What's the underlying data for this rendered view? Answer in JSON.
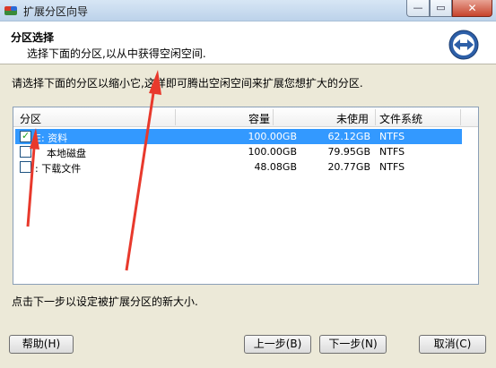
{
  "window": {
    "title": "扩展分区向导",
    "min_glyph": "—",
    "max_glyph": "▭",
    "close_glyph": "✕"
  },
  "header": {
    "title": "分区选择",
    "subtitle": "选择下面的分区,以从中获得空闲空间."
  },
  "instruction": "请选择下面的分区以缩小它,这样即可腾出空闲空间来扩展您想扩大的分区.",
  "table": {
    "columns": [
      "分区",
      "容量",
      "未使用",
      "文件系统"
    ],
    "rows": [
      {
        "checked": true,
        "selected": true,
        "name": "E: 资料",
        "capacity": "100.00GB",
        "unused": "62.12GB",
        "fs": "NTFS"
      },
      {
        "checked": false,
        "selected": false,
        "name": "本地磁盘",
        "capacity": "100.00GB",
        "unused": "79.95GB",
        "fs": "NTFS"
      },
      {
        "checked": false,
        "selected": false,
        "name": ": 下载文件",
        "capacity": "48.08GB",
        "unused": "20.77GB",
        "fs": "NTFS"
      }
    ]
  },
  "footer_hint": "点击下一步以设定被扩展分区的新大小.",
  "buttons": {
    "help": "帮助(H)",
    "back": "上一步(B)",
    "next": "下一步(N)",
    "cancel": "取消(C)"
  },
  "colors": {
    "selection": "#3399ff",
    "annotation_arrow": "#e8392c",
    "dialog_background": "#ece9d8"
  },
  "icons": [
    "app-partition-icon",
    "wizard-extend-icon",
    "checkbox-checked-icon",
    "annotation-arrow"
  ]
}
